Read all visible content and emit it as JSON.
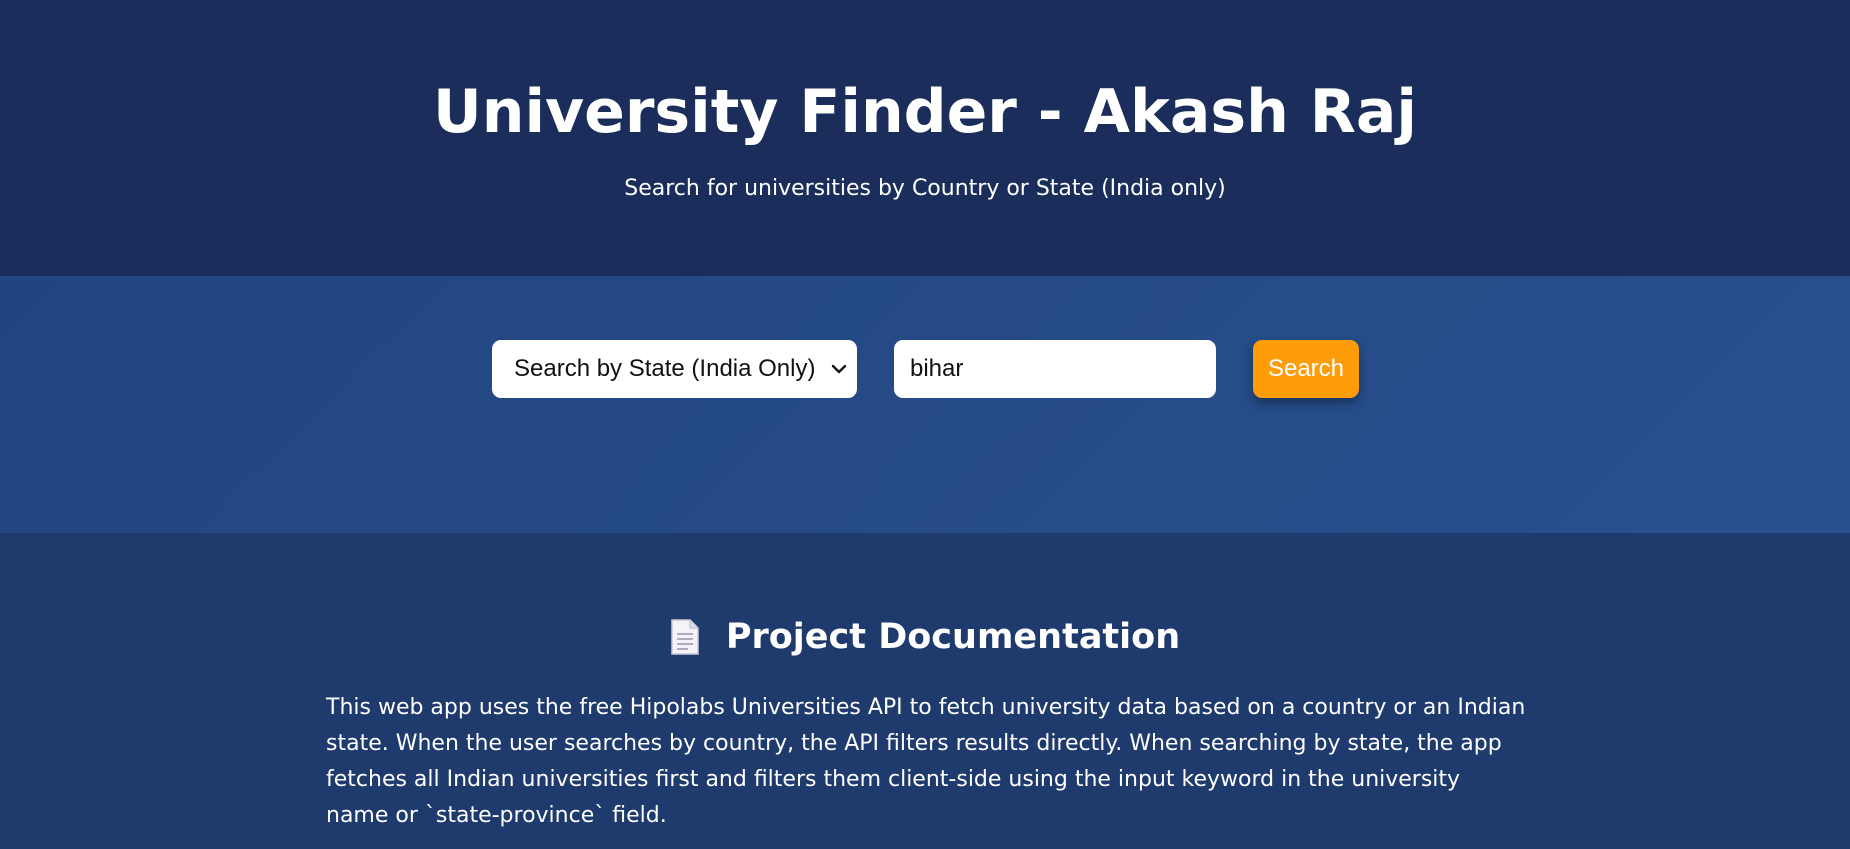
{
  "header": {
    "title": "University Finder - Akash Raj",
    "subtitle": "Search for universities by Country or State (India only)"
  },
  "search": {
    "mode_selected": "Search by State (India Only)",
    "query_value": "bihar",
    "button_label": "Search"
  },
  "docs": {
    "icon": "document-icon",
    "heading": "Project Documentation",
    "body": "This web app uses the free Hipolabs Universities API to fetch university data based on a country or an Indian state. When the user searches by country, the API filters results directly. When searching by state, the app fetches all Indian universities first and filters them client-side using the input keyword in the university name or `state-province` field."
  },
  "colors": {
    "header_bg": "#1b2e5b",
    "search_band_bg": "#264c8a",
    "docs_bg": "#1f3a6c",
    "accent": "#ff9c0a"
  }
}
